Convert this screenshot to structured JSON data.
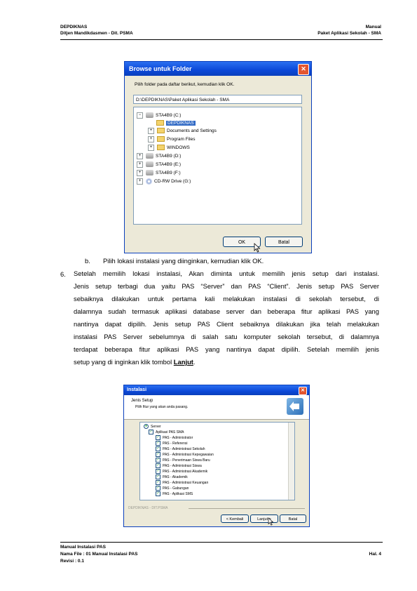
{
  "header": {
    "left_line1": "DEPDIKNAS",
    "left_line2": "Ditjen Mandikdasmen - Dit. PSMA",
    "right_line1": "Manual",
    "right_line2": "Paket Aplikasi Sekolah - SMA"
  },
  "dialog1": {
    "title": "Browse untuk Folder",
    "close_label": "✕",
    "instruction": "Pilih folder pada daftar berikut, kemudian klik OK.",
    "path": "D:\\DEPDIKNAS\\Paket Aplikasi Sekolah - SMA",
    "tree": [
      {
        "toggle": "−",
        "icon": "drive-icon",
        "label": "STA4B9 (C:)"
      },
      {
        "toggle": "",
        "icon": "folder-icon",
        "label": "DEPDIKNAS"
      },
      {
        "toggle": "+",
        "icon": "folder-icon",
        "label": "Documents and Settings"
      },
      {
        "toggle": "+",
        "icon": "folder-icon",
        "label": "Program Files"
      },
      {
        "toggle": "+",
        "icon": "folder-icon",
        "label": "WINDOWS"
      },
      {
        "toggle": "+",
        "icon": "drive-icon",
        "label": "STA4B9 (D:)"
      },
      {
        "toggle": "+",
        "icon": "drive-icon",
        "label": "STA4B9 (E:)"
      },
      {
        "toggle": "+",
        "icon": "drive-icon",
        "label": "STA4B9 (F:)"
      },
      {
        "toggle": "+",
        "icon": "cd-icon",
        "label": "CD-RW Drive (G:)"
      }
    ],
    "ok_label": "OK",
    "cancel_label": "Batal"
  },
  "content": {
    "item_b_marker": "b.",
    "item_b_text": "Pilih lokasi instalasi yang diinginkan, kemudian klik OK.",
    "item_6_marker": "6.",
    "item_6_lines": [
      "Setelah memilih lokasi instalasi, Akan diminta untuk memilih jenis setup dari instalasi.",
      "Jenis setup terbagi dua yaitu PAS “Server” dan PAS “Client”. Jenis setup PAS Server",
      "sebaiknya dilakukan untuk pertama kali melakukan instalasi di sekolah tersebut, di",
      "dalamnya sudah termasuk aplikasi database server dan beberapa fitur aplikasi PAS yang",
      "nantinya dapat dipilih. Jenis setup PAS Client sebaiknya dilakukan jika telah melakukan",
      "instalasi PAS Server sebelumnya di salah satu komputer sekolah tersebut, di dalamnya",
      "terdapat beberapa fitur aplikasi PAS yang nantinya dapat dipilih. Setelah memilih jenis"
    ],
    "item_6_last_prefix": "setup yang di inginkan klik tombol ",
    "item_6_last_link": "Lanjut",
    "item_6_last_suffix": "."
  },
  "dialog2": {
    "title": "Instalasi",
    "close_label": "✕",
    "section_title": "Jenis Setup",
    "section_subtitle": "Pilih fitur yang akan anda pasang.",
    "tree_root": "Server",
    "tree_group": "Aplikasi PAS SMA",
    "features": [
      "PAS - Administrator",
      "PAS - Referensi",
      "PAS - Administrasi Sekolah",
      "PAS - Administrasi Kepegawaian",
      "PAS - Penerimaan Siswa Baru",
      "PAS - Administrasi Siswa",
      "PAS - Administrasi Akademik",
      "PAS - Akademik",
      "PAS - Administrasi Keuangan",
      "PAS - Gabungan",
      "PAS - Aplikasi SMS"
    ],
    "footer_label": "DEPDIKNAS - DIT.PSMA",
    "back_label": "< Kembali",
    "next_label": "Lanjut >",
    "cancel_label": "Batal"
  },
  "footer": {
    "line1": "Manual Instalasi PAS",
    "line2": "Nama File : 01 Manual Instalasi PAS",
    "line3": "Revisi : 0.1",
    "page": "Hal. 4"
  }
}
